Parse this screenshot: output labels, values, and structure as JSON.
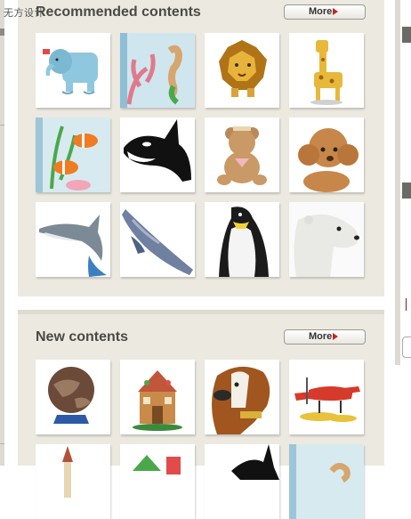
{
  "watermark": "无方设计 ",
  "recommended": {
    "title": "Recommended contents",
    "more_label": "More",
    "items": [
      {
        "icon": "elephant-icon"
      },
      {
        "icon": "seahorse-coral-icon"
      },
      {
        "icon": "lion-icon"
      },
      {
        "icon": "giraffe-icon"
      },
      {
        "icon": "clownfish-icon"
      },
      {
        "icon": "orca-icon"
      },
      {
        "icon": "teddy-bear-icon"
      },
      {
        "icon": "poodle-icon"
      },
      {
        "icon": "dolphin-icon"
      },
      {
        "icon": "blue-whale-icon"
      },
      {
        "icon": "penguin-icon"
      },
      {
        "icon": "polar-bear-icon"
      }
    ]
  },
  "newest": {
    "title": "New contents",
    "more_label": "More",
    "items": [
      {
        "icon": "globe-icon"
      },
      {
        "icon": "gingerbread-house-icon"
      },
      {
        "icon": "st-bernard-dog-icon"
      },
      {
        "icon": "seaplane-icon"
      },
      {
        "icon": "castle-icon"
      },
      {
        "icon": "christmas-house-icon"
      },
      {
        "icon": "orca-icon"
      },
      {
        "icon": "seahorse-icon"
      }
    ]
  },
  "colors": {
    "panel_bg": "#ece9e0",
    "accent_arrow": "#c0281f",
    "title_text": "#4a4a44"
  }
}
